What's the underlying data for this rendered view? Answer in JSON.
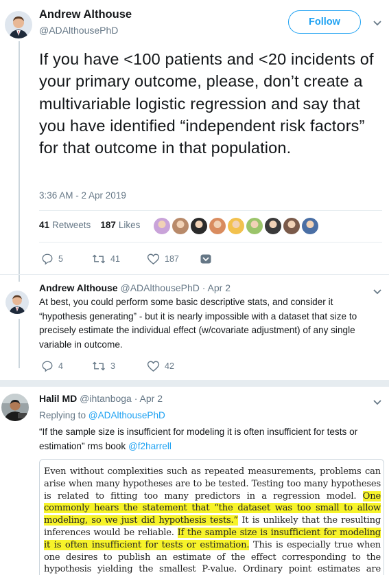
{
  "main_tweet": {
    "name": "Andrew Althouse",
    "handle": "@ADAlthousePhD",
    "follow_label": "Follow",
    "text": "If you have <100 patients and <20 incidents of your primary outcome, please, don’t create a multivariable logistic regression and say that you have identified “independent risk factors” for that outcome in that population.",
    "timestamp": "3:36 AM - 2 Apr 2019",
    "retweets_count": "41",
    "retweets_label": "Retweets",
    "likes_count": "187",
    "likes_label": "Likes",
    "liker_colors": [
      "#c9a3d9",
      "#b88a6a",
      "#2b2b2b",
      "#d98c5f",
      "#f2c14e",
      "#9bc46a",
      "#3a3a3a",
      "#7a5a4a",
      "#4a6fa5"
    ],
    "actions": {
      "replies": "5",
      "retweets": "41",
      "likes": "187"
    }
  },
  "reply_1": {
    "name": "Andrew Althouse",
    "handle": "@ADAlthousePhD",
    "date": "· Apr 2",
    "text": "At best, you could perform some basic descriptive stats, and consider it “hypothesis generating” - but it is nearly impossible with a dataset that size to precisely estimate the individual effect (w/covariate adjustment) of any single variable in outcome.",
    "actions": {
      "replies": "4",
      "retweets": "3",
      "likes": "42"
    }
  },
  "reply_2": {
    "name": "Halil MD",
    "handle": "@ihtanboga",
    "date": "· Apr 2",
    "replying_prefix": "Replying to",
    "replying_to": "@ADAlthousePhD",
    "text_part1": "“If the sample size is insufficient for modeling it is often insufficient for tests or estimation” rms book",
    "text_mention": "@f2harrell",
    "quote": {
      "seg1": "Even without complexities such as repeated measurements, problems can arise when many hypotheses are to be tested. Testing too many hypotheses is related to fitting too many predictors in a regression model. ",
      "hl1": "One commonly hears the statement that “the dataset was too small to allow modeling, so we just did hypothesis tests.”",
      "seg2": " It is unlikely that the resulting inferences would be reliable. ",
      "hl2": "If the sample size is insufficient for modeling it is often insufficient for tests or estimation.",
      "seg3": " This is especially true when one desires to publish an estimate of the effect corresponding to the hypothesis yielding the smallest P-value. Ordinary point estimates are known to be badly biased when"
    }
  }
}
